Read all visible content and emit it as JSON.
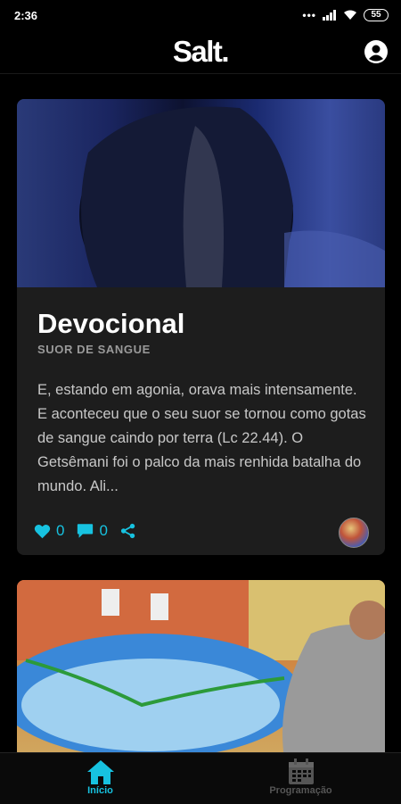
{
  "status_bar": {
    "time": "2:36",
    "battery": "55"
  },
  "app": {
    "logo": "Salt."
  },
  "post": {
    "title": "Devocional",
    "subtitle": "SUOR DE SANGUE",
    "excerpt": "E, estando em agonia, orava mais intensamente. E aconteceu que o seu suor se tornou como gotas de sangue caindo por terra (Lc 22.44). O Getsêmani foi o palco da mais renhida batalha do mundo. Ali...",
    "likes": "0",
    "comments": "0"
  },
  "nav": {
    "home_label": "Início",
    "schedule_label": "Programação"
  },
  "colors": {
    "accent": "#17c2e0",
    "background": "#000000",
    "card": "#1d1d1d"
  }
}
